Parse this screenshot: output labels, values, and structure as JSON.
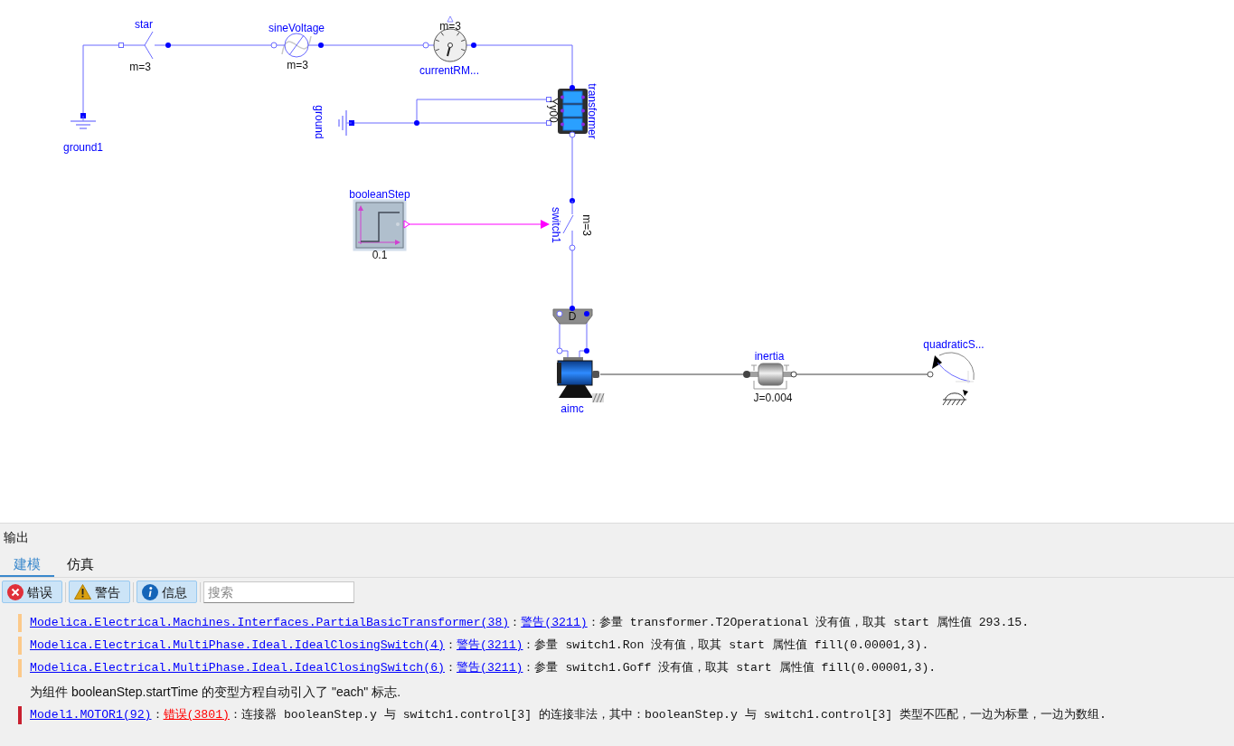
{
  "diagram": {
    "components": [
      {
        "kind": "ground",
        "name": "ground1"
      },
      {
        "kind": "star",
        "name": "star",
        "parameter": "m=3"
      },
      {
        "kind": "sine_voltage",
        "name": "sineVoltage",
        "parameter": "m=3"
      },
      {
        "kind": "rms_sensor",
        "name": "currentRM...",
        "parameter": "m=3"
      },
      {
        "kind": "transformer",
        "name": "transformer",
        "parameter": "Yy00"
      },
      {
        "kind": "ground",
        "name": "ground"
      },
      {
        "kind": "boolean_step",
        "name": "booleanStep",
        "parameter": "0.1"
      },
      {
        "kind": "switch",
        "name": "switch1",
        "parameter": "m=3"
      },
      {
        "kind": "terminal_box",
        "parameter": "D"
      },
      {
        "kind": "machine",
        "name": "aimc"
      },
      {
        "kind": "inertia",
        "name": "inertia",
        "parameter": "J=0.004"
      },
      {
        "kind": "load_torque",
        "name": "quadraticS..."
      }
    ]
  },
  "output_panel": {
    "title": "输出",
    "tabs": [
      {
        "label": "建模",
        "selected": true
      },
      {
        "label": "仿真",
        "selected": false
      }
    ],
    "filters": [
      {
        "kind": "error",
        "label": "错误",
        "on": true
      },
      {
        "kind": "warning",
        "label": "警告",
        "on": true
      },
      {
        "kind": "info",
        "label": "信息",
        "on": true
      }
    ],
    "search": {
      "placeholder": "搜索"
    },
    "messages": [
      {
        "kind": "warning",
        "source": "Modelica.Electrical.Machines.Interfaces.PartialBasicTransformer(38)",
        "separator": "：",
        "code": "警告(3211)",
        "text": "：参量 transformer.T2Operational 没有值，取其 start 属性值 293.15."
      },
      {
        "kind": "warning",
        "source": "Modelica.Electrical.MultiPhase.Ideal.IdealClosingSwitch(4)",
        "separator": "：",
        "code": "警告(3211)",
        "text": "：参量 switch1.Ron 没有值，取其 start 属性值 fill(0.00001,3)."
      },
      {
        "kind": "warning",
        "source": "Modelica.Electrical.MultiPhase.Ideal.IdealClosingSwitch(6)",
        "separator": "：",
        "code": "警告(3211)",
        "text": "：参量 switch1.Goff 没有值，取其 start 属性值 fill(0.00001,3)."
      },
      {
        "kind": "info",
        "text": "为组件 booleanStep.startTime 的变型方程自动引入了 \"each\" 标志."
      },
      {
        "kind": "error",
        "source": "Model1.MOTOR1(92)",
        "separator": "：",
        "code": "错误(3801)",
        "text": "：连接器 booleanStep.y 与 switch1.control[3] 的连接非法，其中：booleanStep.y 与 switch1.control[3] 类型不匹配，一边为标量，一边为数组."
      }
    ]
  }
}
